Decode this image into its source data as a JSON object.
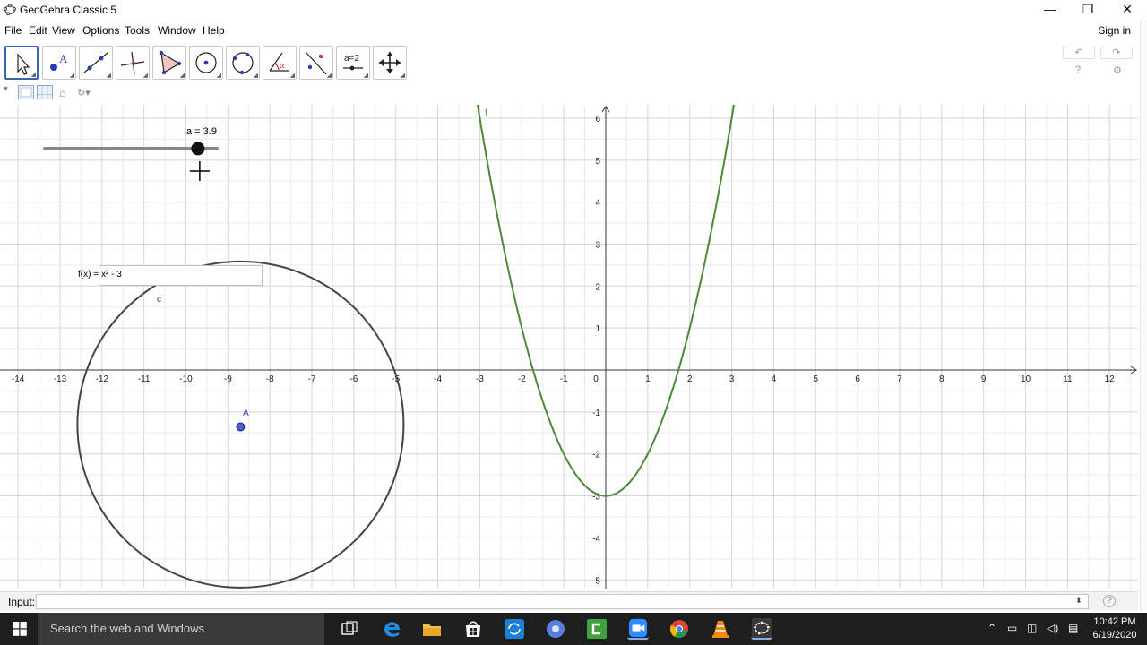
{
  "window": {
    "title": "GeoGebra Classic 5",
    "minimize_glyph": "—",
    "restore_glyph": "❐",
    "close_glyph": "✕"
  },
  "menu": {
    "items": [
      "File",
      "Edit",
      "View",
      "Options",
      "Tools",
      "Window",
      "Help"
    ],
    "signin": "Sign in"
  },
  "toolbar": {
    "tools": [
      {
        "name": "move",
        "icon": "arrow-cursor-icon",
        "active": true
      },
      {
        "name": "point",
        "icon": "point-icon",
        "text": "A"
      },
      {
        "name": "line",
        "icon": "line-through-points-icon"
      },
      {
        "name": "perpendicular",
        "icon": "perpendicular-line-icon"
      },
      {
        "name": "polygon",
        "icon": "polygon-icon"
      },
      {
        "name": "circle",
        "icon": "circle-center-point-icon"
      },
      {
        "name": "ellipse",
        "icon": "ellipse-icon"
      },
      {
        "name": "angle",
        "icon": "angle-icon",
        "text": "α"
      },
      {
        "name": "reflect",
        "icon": "reflect-icon"
      },
      {
        "name": "slider",
        "icon": "slider-icon",
        "text": "a=2"
      },
      {
        "name": "move-graphics",
        "icon": "move-graphics-icon"
      }
    ],
    "undo_glyph": "↶",
    "redo_glyph": "↷",
    "help_glyph": "?",
    "settings_glyph": "⚙"
  },
  "stylebar": {
    "toggle_glyph": "▾",
    "home_glyph": "⌂",
    "zoom_glyph": "↻▾"
  },
  "graphics": {
    "x_axis_ticks": [
      "-14",
      "-13",
      "-12",
      "-11",
      "-10",
      "-9",
      "-8",
      "-7",
      "-6",
      "-5",
      "-4",
      "-3",
      "-2",
      "-1",
      "0",
      "1",
      "2",
      "3",
      "4",
      "5",
      "6",
      "7",
      "8",
      "9",
      "10",
      "11",
      "12"
    ],
    "y_axis_ticks": [
      "-5",
      "-4",
      "-3",
      "-2",
      "-1",
      "1",
      "2",
      "3",
      "4",
      "5",
      "6"
    ],
    "origin_label": "0",
    "function": {
      "label": "f",
      "expression": "x² - 3",
      "color": "#4a8a3a"
    },
    "function_input": {
      "label": "f(x) =",
      "value": "x² - 3"
    },
    "slider": {
      "label": "a = 3.9",
      "value": 3.9,
      "min": -5,
      "max": 5
    },
    "circle": {
      "label": "c",
      "center_label": "A",
      "color": "#444444"
    },
    "point_A": {
      "label": "A",
      "x": -8.7,
      "y": -1.1,
      "color": "#3a4ab0"
    }
  },
  "inputbar": {
    "label": "Input:",
    "value": "",
    "dropdown_glyph": "⬍",
    "help_glyph": "?"
  },
  "taskbar": {
    "search_placeholder": "Search the web and Windows",
    "time": "10:42 PM",
    "date": "6/19/2020"
  }
}
